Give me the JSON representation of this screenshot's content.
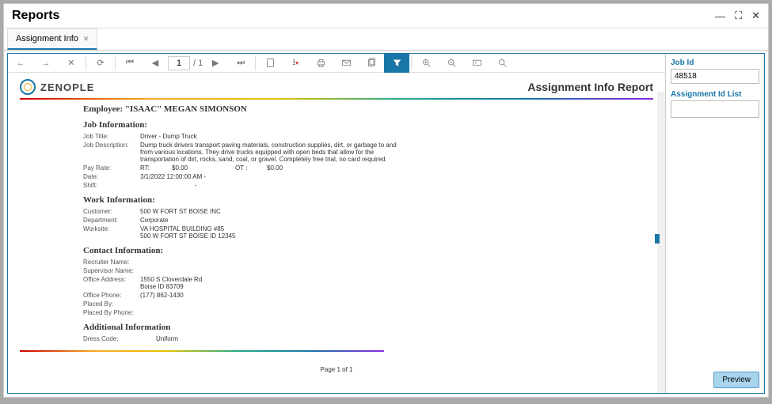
{
  "window": {
    "title": "Reports"
  },
  "tab": {
    "label": "Assignment Info"
  },
  "toolbar": {
    "page_current": "1",
    "page_total": "/ 1"
  },
  "report": {
    "brand": "ZENOPLE",
    "title": "Assignment Info Report",
    "employee_label": "Employee:",
    "employee_name": "\"ISAAC\" MEGAN SIMONSON",
    "sections": {
      "job": "Job Information:",
      "work": "Work Information:",
      "contact": "Contact Information:",
      "additional": "Additional Information"
    },
    "job": {
      "title_lbl": "Job Title:",
      "title": "Driver - Dump Truck",
      "desc_lbl": "Job Description:",
      "desc": "Dump truck drivers transport paving materials, construction supplies, dirt, or garbage to and from various locations. They drive trucks equipped with open beds that allow for the transportation of dirt, rocks, sand, coal, or gravel. Completely free trial, no card required.",
      "pay_lbl": "Pay Rate:",
      "pay_rt_lbl": "RT:",
      "pay_rt": "$0.00",
      "pay_ot_lbl": "OT :",
      "pay_ot": "$0.00",
      "date_lbl": "Date:",
      "date": "3/1/2022 12:00:00 AM  -",
      "shift_lbl": "Shift:",
      "shift": "-"
    },
    "work": {
      "customer_lbl": "Customer:",
      "customer": "500 W FORT ST BOISE INC",
      "dept_lbl": "Department:",
      "dept": "Corporate",
      "worksite_lbl": "Worksite:",
      "worksite1": "VA HOSPITAL BUILDING #85",
      "worksite2": "500 W FORT ST BOISE ID 12345"
    },
    "contact": {
      "recruiter_lbl": "Recruiter Name:",
      "recruiter": "",
      "supervisor_lbl": "Supervisor Name:",
      "supervisor": "",
      "office_addr_lbl": "Office Address:",
      "office_addr1": "1550 S Cloverdale Rd",
      "office_addr2": "Boise ID 83709",
      "office_phone_lbl": "Office Phone:",
      "office_phone": "(177) 862-1430",
      "placed_by_lbl": "Placed By:",
      "placed_by": "",
      "placed_by_phone_lbl": "Placed By Phone:",
      "placed_by_phone": ""
    },
    "additional": {
      "dress_lbl": "Dress Code:",
      "dress": "Uniform"
    },
    "footer": "Page 1 of 1"
  },
  "side": {
    "jobid_label": "Job Id",
    "jobid_value": "48518",
    "assignlist_label": "Assignment Id List",
    "preview": "Preview"
  }
}
